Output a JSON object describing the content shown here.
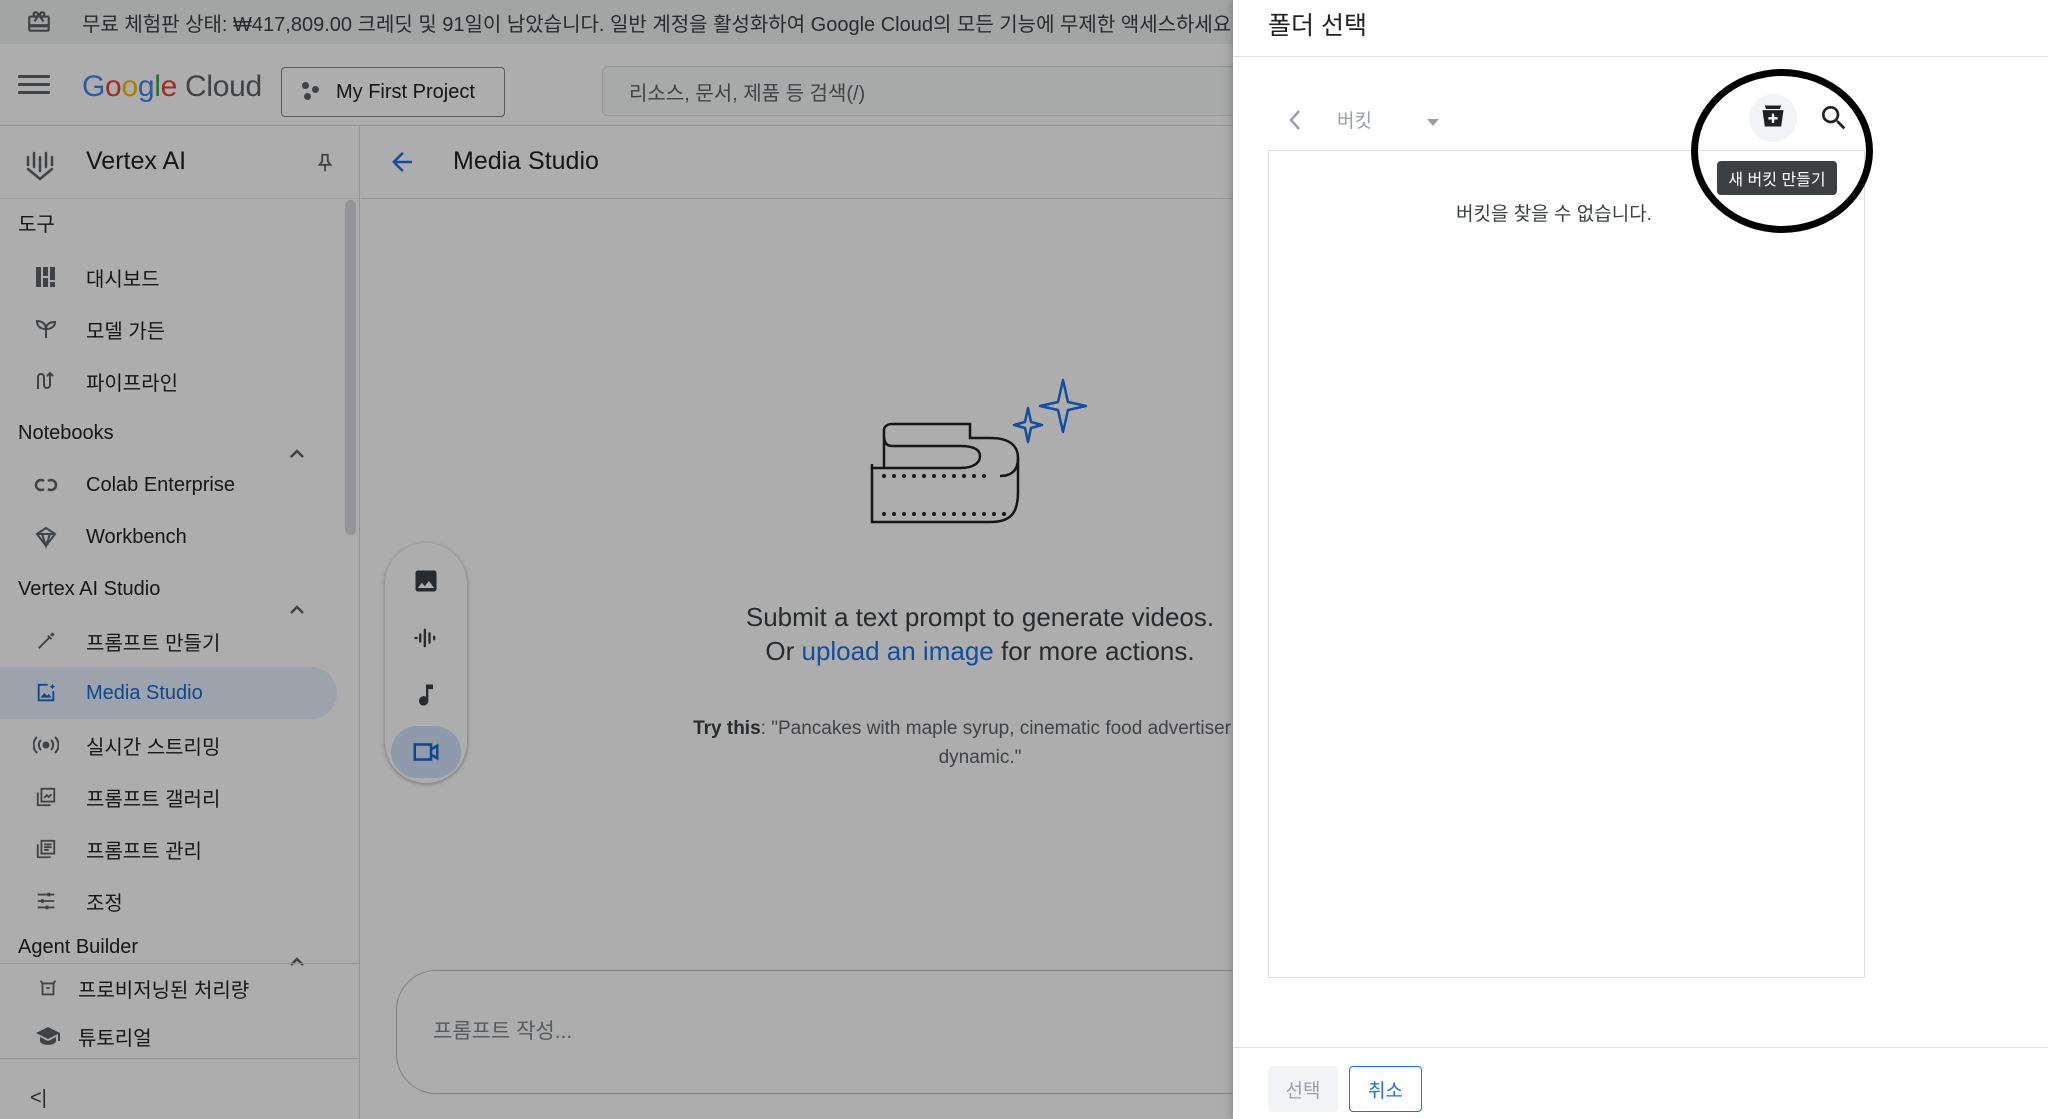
{
  "banner": {
    "text": "무료 체험판 상태: ₩417,809.00 크레딧 및 91일이 남았습니다. 일반 계정을 활성화하여 Google Cloud의 모든 기능에 무제한 액세스하세요. 남아 있"
  },
  "header": {
    "logo_google": [
      "G",
      "o",
      "o",
      "g",
      "l",
      "e"
    ],
    "logo_cloud": "Cloud",
    "project_label": "My First Project",
    "search_placeholder": "리소스, 문서, 제품 등 검색(/)"
  },
  "sidebar": {
    "title": "Vertex AI",
    "sections": {
      "tools": "도구",
      "notebooks": "Notebooks",
      "studio": "Vertex AI Studio",
      "agent": "Agent Builder"
    },
    "tools_items": [
      "대시보드",
      "모델 가든",
      "파이프라인"
    ],
    "notebooks_items": [
      "Colab Enterprise",
      "Workbench"
    ],
    "studio_items": [
      "프롬프트 만들기",
      "Media Studio",
      "실시간 스트리밍",
      "프롬프트 갤러리",
      "프롬프트 관리",
      "조정"
    ],
    "bottom_items": [
      "프로비저닝된 처리량",
      "튜토리얼"
    ],
    "collapse_label": "<|"
  },
  "main": {
    "title": "Media Studio",
    "message_line1": "Submit a text prompt to generate videos.",
    "message_or": "Or ",
    "message_link": "upload an image",
    "message_rest": " for more actions.",
    "try_label": "Try this",
    "try_text": ": \"Pancakes with maple syrup, cinematic food advertiser roll, dynamic.\"",
    "prompt_placeholder": "프롬프트 작성..."
  },
  "dialog": {
    "title": "폴더 선택",
    "breadcrumb": "버킷",
    "empty_message": "버킷을 찾을 수 없습니다.",
    "tooltip": "새 버킷 만들기",
    "select_button": "선택",
    "cancel_button": "취소"
  },
  "colors": {
    "accent": "#1a73e8",
    "active_bg": "#e8f0fe",
    "overlay": "rgba(0,0,0,0.32)",
    "annotation_ring": "#000000"
  },
  "icons": {
    "banner": "gift-icon",
    "menu": "hamburger-menu-icon",
    "project": "project-dots-icon",
    "vertex": "vertex-ai-logo-icon",
    "pin": "pin-icon",
    "back": "arrow-left-icon",
    "image_tool": "image-icon",
    "audio_tool": "waveform-icon",
    "music_tool": "music-note-icon",
    "video_tool": "video-camera-icon",
    "new_bucket": "create-bucket-icon",
    "search": "search-icon"
  }
}
